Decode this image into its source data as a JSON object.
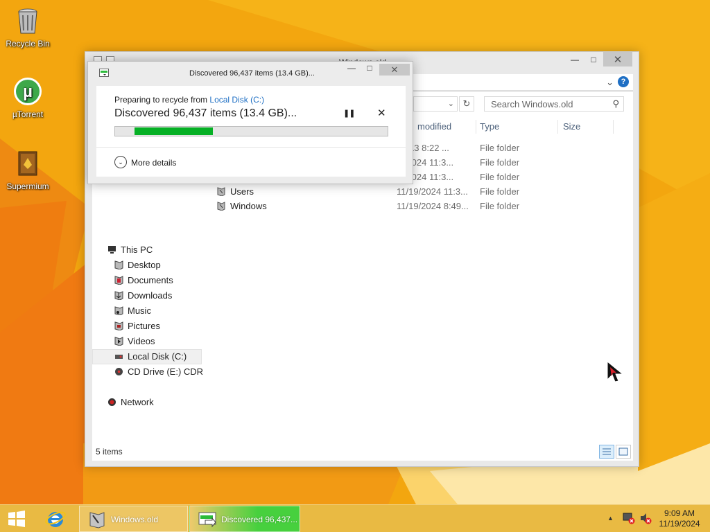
{
  "desktop": {
    "icons": [
      {
        "label": "Recycle Bin",
        "icon": "recycle-bin-icon"
      },
      {
        "label": "µTorrent",
        "icon": "utorrent-icon"
      },
      {
        "label": "Supermium",
        "icon": "supermium-icon"
      }
    ]
  },
  "explorer": {
    "title": "Windows.old",
    "search_placeholder": "Search Windows.old",
    "columns": [
      "modified",
      "Type",
      "Size"
    ],
    "files": [
      {
        "name": "",
        "date": "/2013 8:22 ...",
        "type": "File folder"
      },
      {
        "name": "",
        "date": "/9/2024 11:3...",
        "type": "File folder"
      },
      {
        "name": "",
        "date": "/9/2024 11:3...",
        "type": "File folder"
      },
      {
        "name": "Users",
        "date": "11/19/2024 11:3...",
        "type": "File folder"
      },
      {
        "name": "Windows",
        "date": "11/19/2024 8:49...",
        "type": "File folder"
      }
    ],
    "nav": [
      {
        "label": "This PC",
        "icon": "this-pc-icon",
        "level": 0
      },
      {
        "label": "Desktop",
        "icon": "desktop-folder-icon",
        "level": 1
      },
      {
        "label": "Documents",
        "icon": "documents-folder-icon",
        "level": 1
      },
      {
        "label": "Downloads",
        "icon": "downloads-folder-icon",
        "level": 1
      },
      {
        "label": "Music",
        "icon": "music-folder-icon",
        "level": 1
      },
      {
        "label": "Pictures",
        "icon": "pictures-folder-icon",
        "level": 1
      },
      {
        "label": "Videos",
        "icon": "videos-folder-icon",
        "level": 1
      },
      {
        "label": "Local Disk (C:)",
        "icon": "local-disk-icon",
        "level": 1,
        "selected": true
      },
      {
        "label": "CD Drive (E:) CDR",
        "icon": "cd-drive-icon",
        "level": 1
      },
      {
        "label": "Network",
        "icon": "network-icon",
        "level": 0
      }
    ],
    "status": "5 items"
  },
  "dialog": {
    "title": "Discovered 96,437 items (13.4 GB)...",
    "subtitle_prefix": "Preparing to recycle from ",
    "subtitle_link": "Local Disk (C:)",
    "main_text": "Discovered 96,437 items (13.4 GB)...",
    "progress": 0.31,
    "more_details": "More details"
  },
  "taskbar": {
    "items": [
      {
        "label": "Windows.old",
        "icon": "file-explorer-icon"
      },
      {
        "label": "Discovered 96,437...",
        "icon": "recycle-progress-icon"
      }
    ],
    "clock_time": "9:09 AM",
    "clock_date": "11/19/2024"
  },
  "colors": {
    "accent": "#1e6fc4",
    "progress": "#06b025",
    "wallpaper": "#f3a60f"
  }
}
